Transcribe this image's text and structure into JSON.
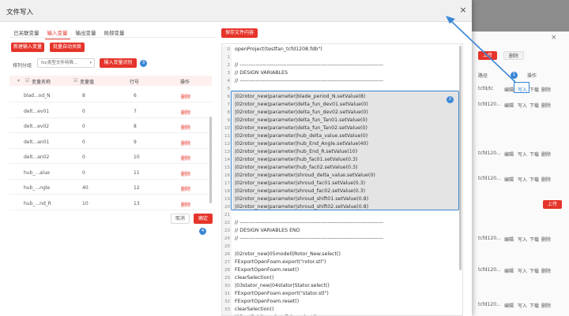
{
  "background": {
    "top_buttons": {
      "upload": "上传",
      "delete": "删除"
    },
    "header_labels": {
      "path": "路径",
      "ops": "操作"
    },
    "rows_top": [
      {
        "path": "tcfd/tc",
        "ops": [
          "编辑",
          "写入",
          "下载",
          "删除"
        ]
      },
      {
        "path": "tcfd120...",
        "ops": [
          "编辑",
          "写入",
          "下载",
          "删除"
        ]
      },
      {
        "path": "tcfd120...",
        "ops": [
          "编辑",
          "写入",
          "下载",
          "删除"
        ]
      },
      {
        "path": "tcfd120...",
        "ops": [
          "编辑",
          "写入",
          "下载",
          "删除"
        ]
      }
    ],
    "mid_buttons": {
      "upload": "上传",
      "delete": "删除"
    },
    "rows_bottom": [
      {
        "path": "tcfd120...",
        "ops": [
          "编辑",
          "写入",
          "下载",
          "删除"
        ]
      },
      {
        "path": "tcfd120...",
        "ops": [
          "编辑",
          "写入",
          "下载",
          "删除"
        ]
      },
      {
        "path": "tcfd120...",
        "ops": [
          "编辑",
          "写入",
          "下载",
          "删除"
        ]
      }
    ]
  },
  "modal": {
    "title": "文件写入",
    "close": "×"
  },
  "tabs": [
    "已关联变量",
    "输入变量",
    "输出变量",
    "局部变量"
  ],
  "buttons": {
    "new_input": "新建输入变量",
    "batch_link": "批量自动关联",
    "identify": "输入变量识别",
    "cancel": "取消",
    "ok": "确定",
    "save_file": "保存文件内容"
  },
  "sort": {
    "label": "排列分组",
    "placeholder": "fsc类型文件特殊..."
  },
  "badges": [
    "1",
    "2",
    "3",
    "4"
  ],
  "table": {
    "headers": [
      "变量名称",
      "变量值",
      "行号",
      "操作"
    ],
    "rows": [
      {
        "name": "blad...od_N",
        "value": "8",
        "line": "6",
        "op": "删除"
      },
      {
        "name": "delt...ev01",
        "value": "0",
        "line": "7",
        "op": "删除"
      },
      {
        "name": "delt...ev02",
        "value": "0",
        "line": "8",
        "op": "删除"
      },
      {
        "name": "delt...an01",
        "value": "0",
        "line": "9",
        "op": "删除"
      },
      {
        "name": "delt...an02",
        "value": "0",
        "line": "10",
        "op": "删除"
      },
      {
        "name": "hub_...alue",
        "value": "0",
        "line": "11",
        "op": "删除"
      },
      {
        "name": "hub_...ngle",
        "value": "40",
        "line": "12",
        "op": "删除"
      },
      {
        "name": "hub_...nd_R",
        "value": "10",
        "line": "13",
        "op": "删除"
      }
    ]
  },
  "editor": {
    "lines": [
      {
        "n": "0",
        "text": "openProject(testfan_tcfd1208.fdb\")"
      },
      {
        "n": "1",
        "text": ""
      },
      {
        "n": "2",
        "text": "// --------------------------------------------------------------------------------"
      },
      {
        "n": "3",
        "text": "// DESIGN VARIABLES"
      },
      {
        "n": "4",
        "text": "// --------------------------------------------------------------------------------"
      },
      {
        "n": "5",
        "text": ""
      },
      {
        "n": "6",
        "text": "|02rotor_new|parameter|blade_period_N.setValue(8)"
      },
      {
        "n": "7",
        "text": "|02rotor_new|parameter|delta_fun_dev01.setValue(0)"
      },
      {
        "n": "8",
        "text": "|02rotor_new|parameter|delta_fun_dev02.setValue(0)"
      },
      {
        "n": "9",
        "text": "|02rotor_new|parameter|delta_fun_Tan01.setValue(0)"
      },
      {
        "n": "10",
        "text": "|02rotor_new|parameter|delta_fun_Tan02.setValue(0)"
      },
      {
        "n": "11",
        "text": "|02rotor_new|parameter|hub_delta_value.setValue(0)"
      },
      {
        "n": "12",
        "text": "|02rotor_new|parameter|hub_End_Angle.setValue(40)"
      },
      {
        "n": "13",
        "text": "|02rotor_new|parameter|hub_End_R.setValue(10)"
      },
      {
        "n": "14",
        "text": "|02rotor_new|parameter|hub_fac01.setValue(0.3)"
      },
      {
        "n": "15",
        "text": "|02rotor_new|parameter|hub_fac02.setValue(0.3)"
      },
      {
        "n": "16",
        "text": "|02rotor_new|parameter|shroud_delta_value.setValue(0)"
      },
      {
        "n": "17",
        "text": "|02rotor_new|parameter|shroud_fac01.setValue(0.3)"
      },
      {
        "n": "18",
        "text": "|02rotor_new|parameter|shroud_fac02.setValue(0.3)"
      },
      {
        "n": "19",
        "text": "|02rotor_new|parameter|shroud_shift01.setValue(0.8)"
      },
      {
        "n": "20",
        "text": "|02rotor_new|parameter|shroud_shift02.setValue(0.8)"
      },
      {
        "n": "21",
        "text": ""
      },
      {
        "n": "22",
        "text": "// --------------------------------------------------------------------------------"
      },
      {
        "n": "23",
        "text": "// DESIGN VARIABLES END"
      },
      {
        "n": "24",
        "text": "// --------------------------------------------------------------------------------"
      },
      {
        "n": "25",
        "text": ""
      },
      {
        "n": "26",
        "text": "|02rotor_new|05modell|Rotor_New.select()"
      },
      {
        "n": "27",
        "text": "FExportOpenFoam.export(\"rotor.stl\")"
      },
      {
        "n": "28",
        "text": "FExportOpenFoam.reset()"
      },
      {
        "n": "29",
        "text": "clearSelection()"
      },
      {
        "n": "30",
        "text": "|03stator_new|04stator|Stator.select()"
      },
      {
        "n": "31",
        "text": "FExportOpenFoam.export(\"stator.stl\")"
      },
      {
        "n": "32",
        "text": "FExportOpenFoam.reset()"
      },
      {
        "n": "33",
        "text": "clearSelection()"
      },
      {
        "n": "34",
        "text": "|05outfield|newOut_Tube.select()"
      }
    ]
  },
  "colors": {
    "accent": "#e5342a",
    "highlight": "#3a86d6"
  }
}
